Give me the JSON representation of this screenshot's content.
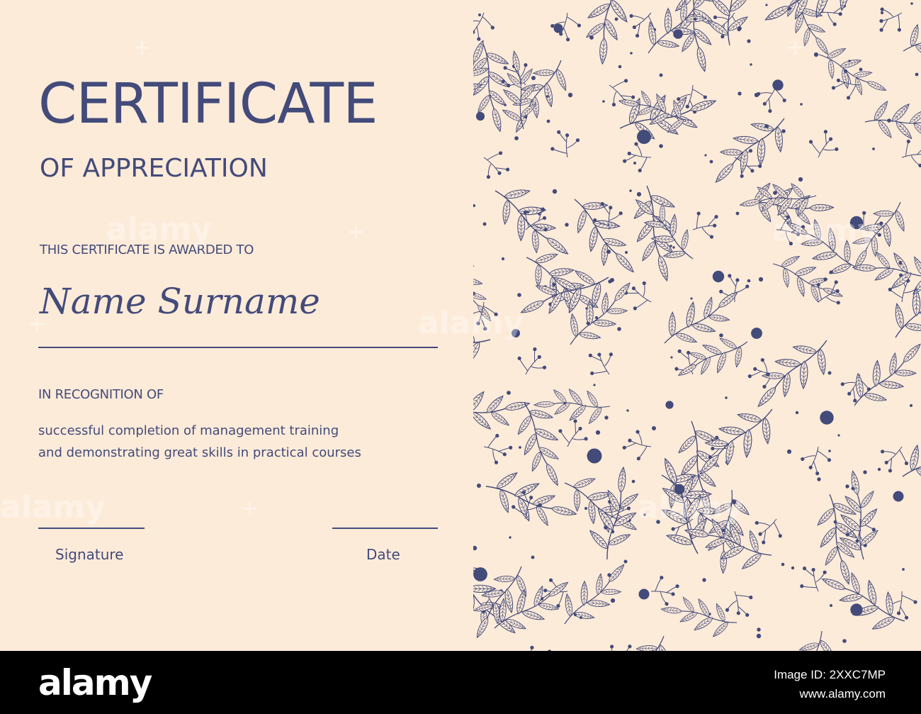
{
  "certificate": {
    "title": "CERTIFICATE",
    "subtitle": "OF APPRECIATION",
    "awarded_label": "THIS CERTIFICATE IS AWARDED TO",
    "recipient_name": "Name Surname",
    "recognition_label": "IN RECOGNITION OF",
    "recognition_text": [
      "successful completion of management training",
      "and demonstrating great skills in practical courses"
    ],
    "signature_label": "Signature",
    "date_label": "Date"
  },
  "colors": {
    "background": "#fdebd9",
    "ink": "#434b7a",
    "leaf_fill": "#fbe9d8",
    "watermark": "rgba(255,255,255,0.35)"
  },
  "pattern": {
    "motif": "botanical-leaf-sprigs-with-berries"
  },
  "watermark_text": "alamy",
  "stock_bar": {
    "logo": "alamy",
    "image_id": "Image ID: 2XXC7MP",
    "site": "www.alamy.com"
  }
}
